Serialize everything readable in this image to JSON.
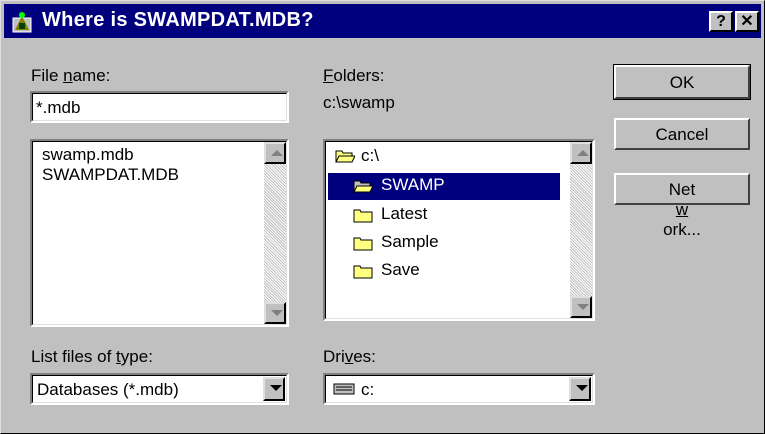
{
  "window": {
    "title": "Where is SWAMPDAT.MDB?",
    "help_button": "?",
    "close_button": "✕"
  },
  "file_name": {
    "label_pre": "File ",
    "label_key": "n",
    "label_post": "ame:",
    "value": "*.mdb",
    "files": [
      "swamp.mdb",
      "SWAMPDAT.MDB"
    ]
  },
  "folders": {
    "label_key": "F",
    "label_post": "olders:",
    "current_path": "c:\\swamp",
    "items": [
      {
        "label": "c:\\",
        "icon": "open-folder-icon",
        "selected": false
      },
      {
        "label": "SWAMP",
        "icon": "open-folder-icon",
        "selected": true
      },
      {
        "label": "Latest",
        "icon": "folder-icon",
        "selected": false
      },
      {
        "label": "Sample",
        "icon": "folder-icon",
        "selected": false
      },
      {
        "label": "Save",
        "icon": "folder-icon",
        "selected": false
      }
    ]
  },
  "file_type": {
    "label_pre": "List files of ",
    "label_key": "t",
    "label_post": "ype:",
    "value": "Databases (*.mdb)"
  },
  "drives": {
    "label_pre": "Dri",
    "label_key": "v",
    "label_post": "es:",
    "value": "c:",
    "icon": "drive-icon"
  },
  "buttons": {
    "ok": "OK",
    "cancel": "Cancel",
    "network_pre": "Net",
    "network_key": "w",
    "network_post": "ork..."
  },
  "colors": {
    "titlebar": "#00007f",
    "face": "#c0c0c0",
    "selection": "#00007f",
    "folder": "#ffff80"
  }
}
